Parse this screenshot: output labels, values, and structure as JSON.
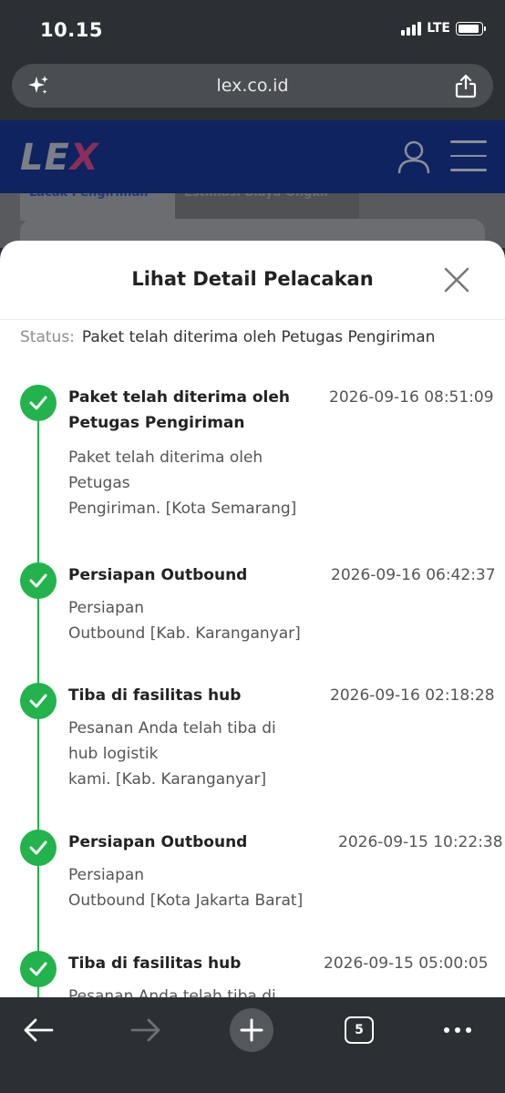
{
  "status_bar": {
    "time": "10.15",
    "network": "LTE"
  },
  "browser": {
    "url": "lex.co.id",
    "tab_count": "5"
  },
  "site": {
    "logo_lx": "LE",
    "logo_x": "X",
    "bg_tab_1": "Lacak Pengiriman",
    "bg_tab_2": "Estimasi Biaya Ongkir"
  },
  "sheet": {
    "title": "Lihat Detail Pelacakan",
    "status_label": "Status:",
    "status_value": "Paket telah diterima oleh Petugas Pengiriman",
    "events": [
      {
        "title": "Paket telah diterima oleh Petugas Pengiriman",
        "time": "2026-09-16 08:51:09",
        "desc_1": "Paket telah diterima oleh",
        "desc_2": "Petugas",
        "desc_3": "Pengiriman. [Kota Semarang]"
      },
      {
        "title": "Persiapan Outbound",
        "time": "2026-09-16 06:42:37",
        "desc_1": "Persiapan",
        "desc_2": "Outbound [Kab. Karanganyar]"
      },
      {
        "title": "Tiba di fasilitas hub",
        "time": "2026-09-16 02:18:28",
        "desc_1": "Pesanan Anda telah tiba di",
        "desc_2": "hub logistik",
        "desc_3": "kami. [Kab. Karanganyar]"
      },
      {
        "title": "Persiapan Outbound",
        "time": "2026-09-15 10:22:38",
        "desc_1": "Persiapan",
        "desc_2": "Outbound [Kota Jakarta Barat]"
      },
      {
        "title": "Tiba di fasilitas hub",
        "time": "2026-09-15 05:00:05",
        "desc_1": "Pesanan Anda telah tiba di"
      }
    ]
  },
  "colors": {
    "accent_green": "#22b34c",
    "browser_chrome": "#2c2f33",
    "site_header": "#0e2360"
  }
}
